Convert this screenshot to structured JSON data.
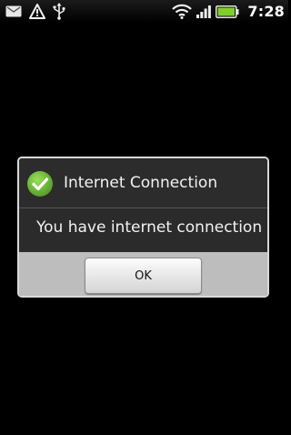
{
  "status_bar": {
    "time": "7:28",
    "icons": [
      "message-icon",
      "warning-icon",
      "usb-icon",
      "wifi-icon",
      "signal-icon",
      "battery-icon"
    ]
  },
  "dialog": {
    "title": "Internet Connection",
    "message": "You have internet connection",
    "ok_label": "OK",
    "icon": "check-icon",
    "accent_color": "#6ab43a"
  }
}
